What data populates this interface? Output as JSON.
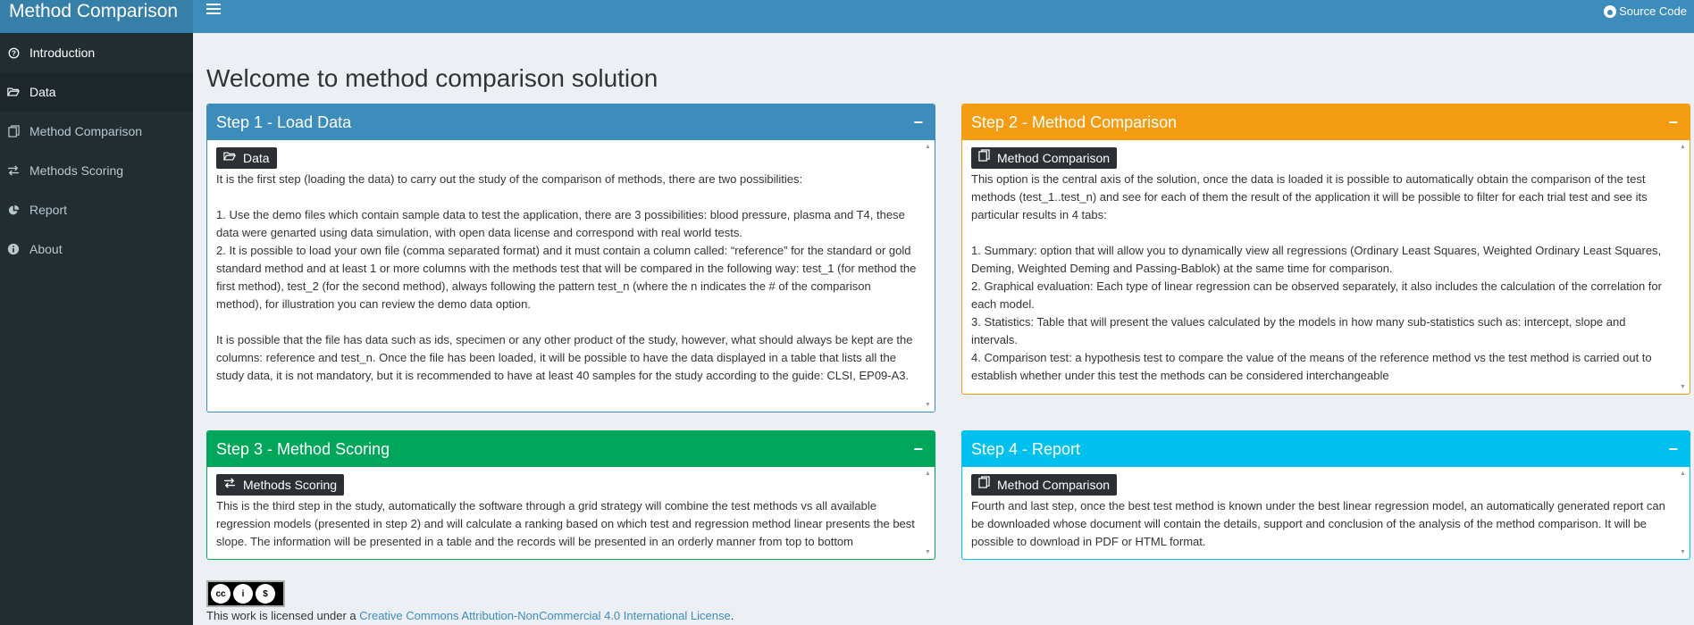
{
  "header": {
    "brand": "Method Comparison",
    "source_label": "Source Code"
  },
  "sidebar": {
    "items": [
      {
        "label": "Introduction",
        "icon": "question-circle-icon"
      },
      {
        "label": "Data",
        "icon": "folder-open-icon"
      },
      {
        "label": "Method Comparison",
        "icon": "copy-icon"
      },
      {
        "label": "Methods Scoring",
        "icon": "exchange-icon"
      },
      {
        "label": "Report",
        "icon": "pie-chart-icon"
      },
      {
        "label": "About",
        "icon": "info-circle-icon"
      }
    ]
  },
  "page": {
    "title": "Welcome to method comparison solution"
  },
  "boxes": {
    "step1": {
      "title": "Step 1 - Load Data",
      "button": "Data",
      "p1": "It is the first step (loading the data) to carry out the study of the comparison of methods, there are two possibilities:",
      "p2": "1. Use the demo files which contain sample data to test the application, there are 3 possibilities: blood pressure, plasma and T4, these data were genarted using data simulation, with open data license and correspond with real world tests.",
      "p3": "2. It is possible to load your own file (comma separated format) and it must contain a column called: “reference” for the standard or gold standard method and at least 1 or more columns with the methods test that will be compared in the following way: test_1 (for method the first method), test_2 (for the second method), always following the pattern test_n (where the n indicates the # of the comparison method), for illustration you can review the demo data option.",
      "p4": "It is possible that the file has data such as ids, specimen or any other product of the study, however, what should always be kept are the columns: reference and test_n. Once the file has been loaded, it will be possible to have the data displayed in a table that lists all the study data, it is not mandatory, but it is recommended to have at least 40 samples for the study according to the guide: CLSI, EP09-A3."
    },
    "step2": {
      "title": "Step 2 - Method Comparison",
      "button": "Method Comparison",
      "p1": "This option is the central axis of the solution, once the data is loaded it is possible to automatically obtain the comparison of the test methods (test_1..test_n) and see for each of them the result of the application it will be possible to filter for each trial test and see its particular results in 4 tabs:",
      "p2": "1. Summary: option that will allow you to dynamically view all regressions (Ordinary Least Squares, Weighted Ordinary Least Squares, Deming, Weighted Deming and Passing-Bablok) at the same time for comparison.",
      "p3": "2. Graphical evaluation: Each type of linear regression can be observed separately, it also includes the calculation of the correlation for each model.",
      "p4": "3. Statistics: Table that will present the values calculated by the models in how many sub-statistics such as: intercept, slope and intervals.",
      "p5": "4. Comparison test: a hypothesis test to compare the value of the means of the reference method vs the test method is carried out to establish whether under this test the methods can be considered interchangeable"
    },
    "step3": {
      "title": "Step 3 - Method Scoring",
      "button": "Methods Scoring",
      "p1": "This is the third step in the study, automatically the software through a grid strategy will combine the test methods vs all available regression models (presented in step 2) and will calculate a ranking based on which test and regression method linear presents the best slope. The information will be presented in a table and the records will be presented in an orderly manner from top to bottom"
    },
    "step4": {
      "title": "Step 4 - Report",
      "button": "Method Comparison",
      "p1": "Fourth and last step, once the best test method is known under the best linear regression model, an automatically generated report can be downloaded whose document will contain the details, support and conclusion of the analysis of the method comparison. It will be possible to download in PDF or HTML format."
    },
    "collapse_symbol": "−"
  },
  "footer": {
    "prefix": "This work is licensed under a ",
    "link": "Creative Commons Attribution-NonCommercial 4.0 International License",
    "suffix": ".",
    "badge_cc": "cc",
    "badge_by": "i",
    "badge_nc": "$"
  },
  "colors": {
    "primary": "#3c8dbc",
    "warning": "#f39c12",
    "success": "#00a65a",
    "info": "#00c0ef",
    "sidebar": "#222d32"
  }
}
